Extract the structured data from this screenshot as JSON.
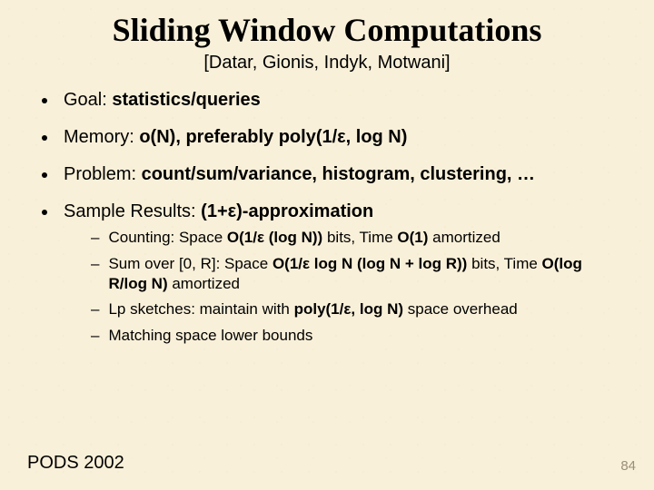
{
  "title": "Sliding Window Computations",
  "subtitle": "[Datar, Gionis, Indyk, Motwani]",
  "bullets": {
    "b1": {
      "label": "Goal: ",
      "value": "statistics/queries"
    },
    "b2": {
      "label": "Memory: ",
      "value": "o(N), preferably poly(1/ε, log N)"
    },
    "b3": {
      "label": "Problem: ",
      "value": "count/sum/variance, histogram, clustering, …"
    },
    "b4": {
      "label": "Sample Results: ",
      "value": "(1+ε)-approximation"
    }
  },
  "subs": {
    "s1": {
      "pre": "Counting: Space ",
      "bold1": "O(1/ε (log N))",
      "mid": " bits, Time ",
      "bold2": "O(1)",
      "post": " amortized"
    },
    "s2": {
      "pre": "Sum over [0, R]: Space ",
      "bold1": "O(1/ε log N (log N + log R))",
      "mid": " bits, Time ",
      "bold2": "O(log R/log N)",
      "post": " amortized"
    },
    "s3": {
      "pre": "Lp sketches: maintain with ",
      "bold1": "poly(1/ε, log N)",
      "post": " space overhead"
    },
    "s4": {
      "text": "Matching space lower bounds"
    }
  },
  "footer": {
    "left": "PODS 2002",
    "right": "84"
  }
}
